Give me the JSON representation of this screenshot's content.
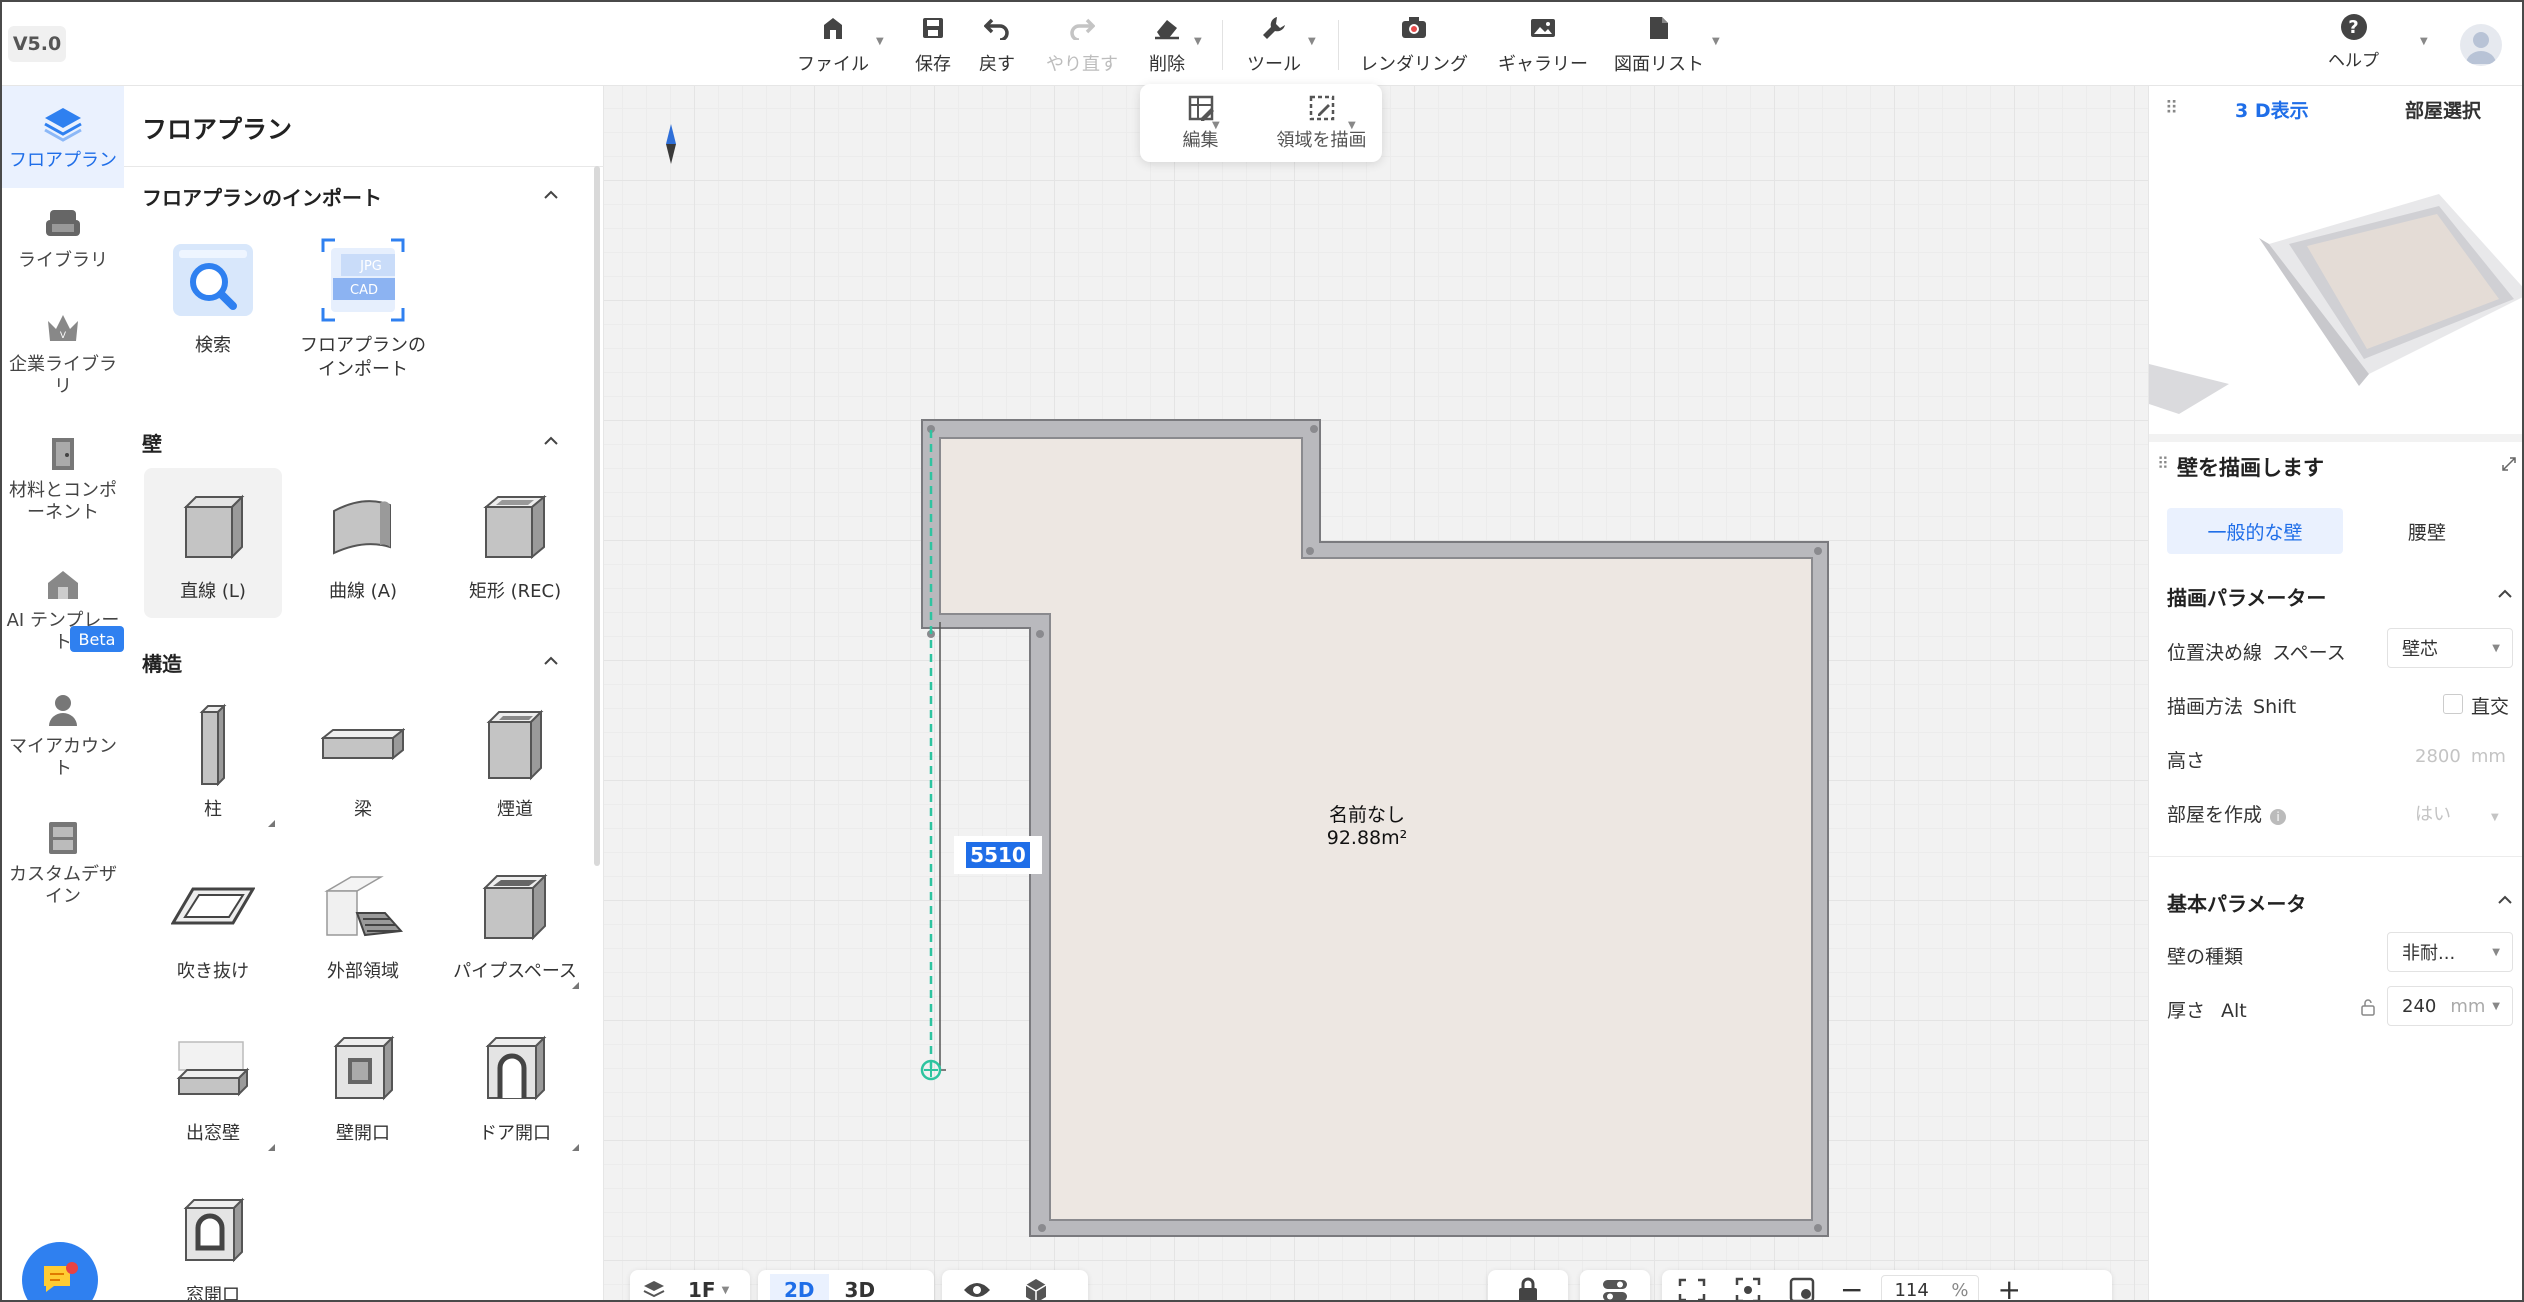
{
  "app": {
    "version": "V5.0"
  },
  "toolbar": {
    "file": "ファイル",
    "save": "保存",
    "undo": "戻す",
    "redo": "やり直す",
    "delete": "削除",
    "tools": "ツール",
    "rendering": "レンダリング",
    "gallery": "ギャラリー",
    "drawing_list": "図面リスト",
    "help": "ヘルプ"
  },
  "sidebar": {
    "items": [
      {
        "label": "フロアプラン",
        "active": true
      },
      {
        "label": "ライブラリ"
      },
      {
        "label": "企業ライブラリ"
      },
      {
        "label": "材料とコンポーネント"
      },
      {
        "label": "AI テンプレート"
      },
      {
        "label": "マイアカウント"
      },
      {
        "label": "カスタムデザイン"
      }
    ],
    "beta_badge": "Beta"
  },
  "panel": {
    "title": "フロアプラン",
    "import_section": "フロアプランのインポート",
    "import_items": [
      "検索",
      "フロアプランの\nインポート"
    ],
    "import_badges": {
      "jpg": "JPG",
      "cad": "CAD"
    },
    "wall_section": "壁",
    "wall_items": [
      "直線 (L)",
      "曲線 (A)",
      "矩形 (REC)"
    ],
    "structure_section": "構造",
    "structure_items": [
      "柱",
      "梁",
      "煙道",
      "吹き抜け",
      "外部領域",
      "パイプスペース",
      "出窓壁",
      "壁開口",
      "ドア開口",
      "窓開口"
    ]
  },
  "canvas": {
    "subtools": [
      "編集",
      "領域を描画"
    ],
    "dimension": "5510",
    "room_name": "名前なし",
    "room_area": "92.88m²",
    "floor": "1F",
    "view_2d": "2D",
    "view_3d": "3D",
    "zoom_value": "114",
    "zoom_unit": "%"
  },
  "right": {
    "tabs": [
      "3 D表示",
      "部屋選択"
    ],
    "title": "壁を描画します",
    "wall_types": [
      "一般的な壁",
      "腰壁"
    ],
    "draw_params": "描画パラメーター",
    "position_label": "位置決め線",
    "position_key": "スペース",
    "position_value": "壁芯",
    "method_label": "描画方法",
    "method_key": "Shift",
    "ortho_label": "直交",
    "height_label": "高さ",
    "height_value": "2800",
    "height_unit": "mm",
    "create_room_label": "部屋を作成",
    "create_room_value": "はい",
    "basic_params": "基本パラメータ",
    "wall_kind_label": "壁の種類",
    "wall_kind_value": "非耐...",
    "thickness_label": "厚さ",
    "thickness_key": "Alt",
    "thickness_value": "240",
    "thickness_unit": "mm"
  },
  "colors": {
    "accent": "#1f6ee8",
    "wall": "#b9b9bd",
    "floor": "#ede7e2",
    "guide": "#2ec4a0"
  }
}
